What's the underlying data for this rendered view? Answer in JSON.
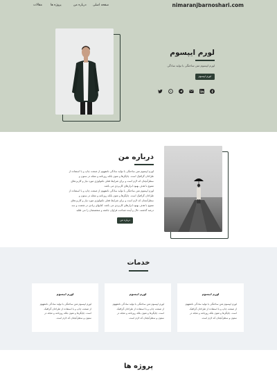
{
  "nav": {
    "brand": "nimaranjbarnoshari.com",
    "items": [
      "صفحه اصلی",
      "درباره من",
      "پروژه ها",
      "مقالات"
    ]
  },
  "hero": {
    "title": "لورم ایپسوم",
    "subtitle": "لورم ایپسوم متن ساختگی با تولید سادگی",
    "button_label": "لورم ایپسوم",
    "socials": [
      "facebook-icon",
      "linkedin-icon",
      "email-icon",
      "telegram-icon",
      "whatsapp-icon",
      "twitter-icon"
    ]
  },
  "about": {
    "title": "درباره من",
    "paragraph_1": "لورم ایپسوم متن ساختگی با تولید سادگی نامفهوم از صنعت چاپ و با استفاده از طراحان گرافیک است. چاپگرها و متون بلکه روزنامه و مجله در ستون و سطرآنچنان که لازم است و برای شرایط فعلی تکنولوژی مورد نیاز و کاربردهای متنوع با هدف بهبود ابزارهای کاربردی می باشد.",
    "paragraph_2": "لورم ایپسوم متن ساختگی با تولید سادگی نامفهوم از صنعت چاپ و با استفاده از طراحان گرافیک است. چاپگرها و متون بلکه روزنامه و مجله در ستون و سطرآنچنان که لازم است و برای شرایط فعلی تکنولوژی مورد نیاز و کاربردهای متنوع با هدف بهبود ابزارهای کاربردی می باشد. کتابهای زیادی در شصت و سه درصد گذشته، حال و آینده شناخت فراوان جامعه و متخصصان را می طلبد",
    "button_label": "درباره من"
  },
  "services": {
    "title": "خدمات",
    "cards": [
      {
        "title": "لورم ایپسوم",
        "text": "لورم ایپسوم متن ساختگی با تولید سادگی نامفهوم از صنعت چاپ و با استفاده از طراحان گرافیک است. چاپگرها و متون بلکه روزنامه و مجله در ستون و سطرآنچنان که لازم است."
      },
      {
        "title": "لورم ایپسوم",
        "text": "لورم ایپسوم متن ساختگی با تولید سادگی نامفهوم از صنعت چاپ و با استفاده از طراحان گرافیک است. چاپگرها و متون بلکه روزنامه و مجله در ستون و سطرآنچنان که لازم است."
      },
      {
        "title": "لورم ایپسوم",
        "text": "لورم ایپسوم متن ساختگی با تولید سادگی نامفهوم از صنعت چاپ و با استفاده از طراحان گرافیک است. چاپگرها و متون بلکه روزنامه و مجله در ستون و سطرآنچنان که لازم است."
      }
    ]
  },
  "projects": {
    "title": "پروژه ها"
  },
  "colors": {
    "hero_bg": "#cbd3c5",
    "accent": "#2d3e34",
    "services_bg": "#eef1f4"
  }
}
